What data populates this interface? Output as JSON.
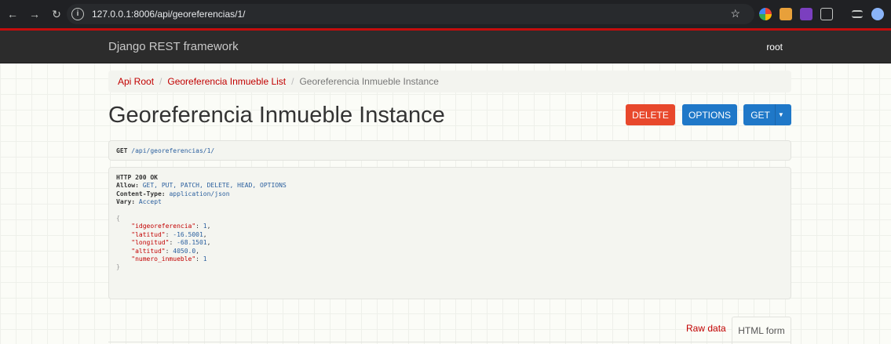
{
  "browser": {
    "url": "127.0.0.1:8006/api/georeferencias/1/",
    "icons": [
      "back-icon",
      "forward-icon",
      "reload-icon",
      "site-info-icon",
      "bookmark-star-icon"
    ]
  },
  "navbar": {
    "brand": "Django REST framework",
    "user": "root"
  },
  "breadcrumb": {
    "items": [
      "Api Root",
      "Georeferencia Inmueble List",
      "Georeferencia Inmueble Instance"
    ]
  },
  "page": {
    "title": "Georeferencia Inmueble Instance"
  },
  "buttons": {
    "delete": "DELETE",
    "options": "OPTIONS",
    "get": "GET"
  },
  "request": {
    "method": "GET",
    "path": "/api/georeferencias/1/"
  },
  "response": {
    "status": "HTTP 200 OK",
    "headers": [
      {
        "name": "Allow:",
        "value": "GET, PUT, PATCH, DELETE, HEAD, OPTIONS"
      },
      {
        "name": "Content-Type:",
        "value": "application/json"
      },
      {
        "name": "Vary:",
        "value": "Accept"
      }
    ],
    "body": [
      {
        "key": "\"idgeoreferencia\"",
        "value": "1"
      },
      {
        "key": "\"latitud\"",
        "value": "-16.5001"
      },
      {
        "key": "\"longitud\"",
        "value": "-68.1501"
      },
      {
        "key": "\"altitud\"",
        "value": "4050.0"
      },
      {
        "key": "\"numero_inmueble\"",
        "value": "1"
      }
    ]
  },
  "tabs": {
    "raw": "Raw data",
    "html": "HTML form"
  },
  "colors": {
    "accent": "#c20000",
    "primary": "#1f78c8",
    "danger": "#e8482c",
    "navbar": "#2c2c2c"
  }
}
